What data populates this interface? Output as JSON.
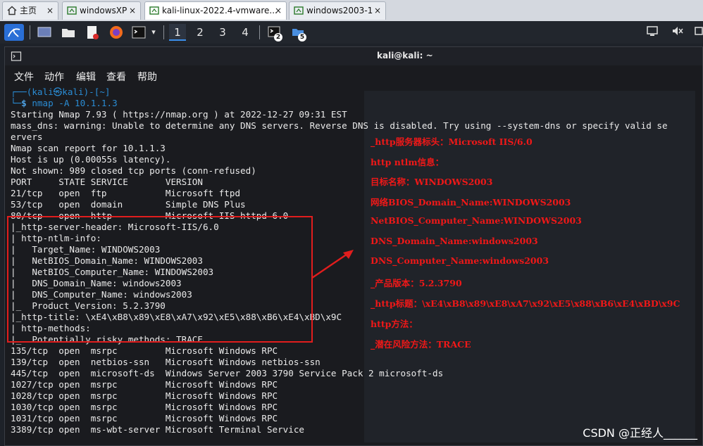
{
  "tabs": [
    {
      "label": "主页",
      "active": false
    },
    {
      "label": "windowsXP",
      "active": false
    },
    {
      "label": "kali-linux-2022.4-vmware...",
      "active": true
    },
    {
      "label": "windows2003-1",
      "active": false
    }
  ],
  "tab_close": "×",
  "panel": {
    "workspaces": [
      "1",
      "2",
      "3",
      "4"
    ],
    "terminal_badge": "2",
    "files_badge": "5"
  },
  "terminal": {
    "title": "kali@kali: ~",
    "menu": [
      "文件",
      "动作",
      "编辑",
      "查看",
      "帮助"
    ]
  },
  "console_lines": [
    {
      "kind": "prompt1",
      "text": "┌──(kali㉿kali)-[~]"
    },
    {
      "kind": "prompt2",
      "cmd": "nmap -A 10.1.1.3"
    },
    {
      "kind": "out",
      "text": "Starting Nmap 7.93 ( https://nmap.org ) at 2022-12-27 09:31 EST"
    },
    {
      "kind": "out",
      "text": "mass_dns: warning: Unable to determine any DNS servers. Reverse DNS is disabled. Try using --system-dns or specify valid se"
    },
    {
      "kind": "out",
      "text": "ervers"
    },
    {
      "kind": "out",
      "text": "Nmap scan report for 10.1.1.3"
    },
    {
      "kind": "out",
      "text": "Host is up (0.00055s latency)."
    },
    {
      "kind": "out",
      "text": "Not shown: 989 closed tcp ports (conn-refused)"
    },
    {
      "kind": "out",
      "text": "PORT     STATE SERVICE       VERSION"
    },
    {
      "kind": "out",
      "text": "21/tcp   open  ftp           Microsoft ftpd"
    },
    {
      "kind": "out",
      "text": "53/tcp   open  domain        Simple DNS Plus"
    },
    {
      "kind": "out",
      "text": "80/tcp   open  http          Microsoft IIS httpd 6.0"
    },
    {
      "kind": "out",
      "text": "|_http-server-header: Microsoft-IIS/6.0"
    },
    {
      "kind": "out",
      "text": "| http-ntlm-info:"
    },
    {
      "kind": "out",
      "text": "|   Target_Name: WINDOWS2003"
    },
    {
      "kind": "out",
      "text": "|   NetBIOS_Domain_Name: WINDOWS2003"
    },
    {
      "kind": "out",
      "text": "|   NetBIOS_Computer_Name: WINDOWS2003"
    },
    {
      "kind": "out",
      "text": "|   DNS_Domain_Name: windows2003"
    },
    {
      "kind": "out",
      "text": "|   DNS_Computer_Name: windows2003"
    },
    {
      "kind": "out",
      "text": "|_  Product_Version: 5.2.3790"
    },
    {
      "kind": "out",
      "text": "|_http-title: \\xE4\\xB8\\x89\\xE8\\xA7\\x92\\xE5\\x88\\xB6\\xE4\\xBD\\x9C"
    },
    {
      "kind": "out",
      "text": "| http-methods:"
    },
    {
      "kind": "out",
      "text": "|_  Potentially risky methods: TRACE"
    },
    {
      "kind": "out",
      "text": "135/tcp  open  msrpc         Microsoft Windows RPC"
    },
    {
      "kind": "out",
      "text": "139/tcp  open  netbios-ssn   Microsoft Windows netbios-ssn"
    },
    {
      "kind": "out",
      "text": "445/tcp  open  microsoft-ds  Windows Server 2003 3790 Service Pack 2 microsoft-ds"
    },
    {
      "kind": "out",
      "text": "1027/tcp open  msrpc         Microsoft Windows RPC"
    },
    {
      "kind": "out",
      "text": "1028/tcp open  msrpc         Microsoft Windows RPC"
    },
    {
      "kind": "out",
      "text": "1030/tcp open  msrpc         Microsoft Windows RPC"
    },
    {
      "kind": "out",
      "text": "1031/tcp open  msrpc         Microsoft Windows RPC"
    },
    {
      "kind": "out",
      "text": "3389/tcp open  ms-wbt-server Microsoft Terminal Service"
    }
  ],
  "annotations": [
    "_http服务器标头：Microsoft IIS/6.0",
    "http ntlm信息：",
    "目标名称：WINDOWS2003",
    "网络BIOS_Domain_Name:WINDOWS2003",
    "NetBIOS_Computer_Name:WINDOWS2003",
    "DNS_Domain_Name:windows2003",
    "DNS_Computer_Name:windows2003",
    "_产品版本：5.2.3790",
    "_http标题：\\xE4\\xB8\\x89\\xE8\\xA7\\x92\\xE5\\x88\\xB6\\xE4\\xBD\\x9C",
    "http方法：",
    "_潜在风险方法：TRACE"
  ],
  "watermark": "CSDN @正经人______",
  "colors": {
    "annotation": "#f01818",
    "prompt": "#2a8cd4",
    "terminal_bg": "#1a1b1f"
  }
}
